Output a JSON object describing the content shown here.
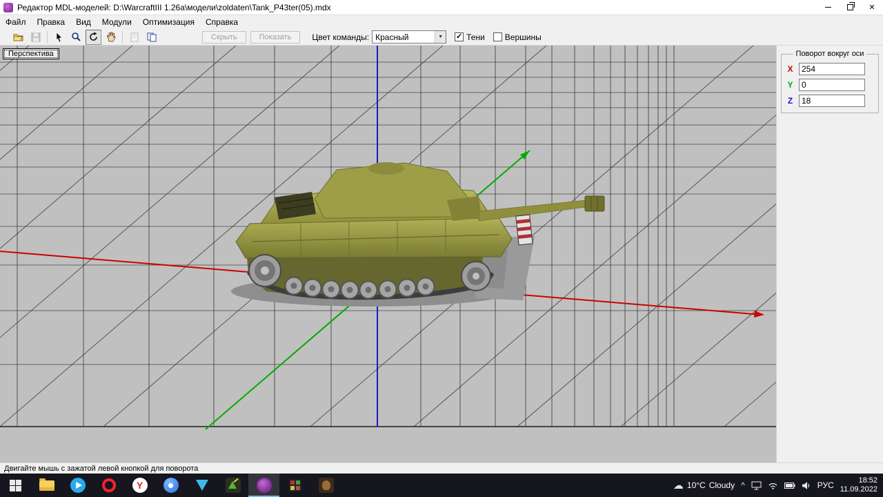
{
  "window": {
    "title": "Редактор MDL-моделей: D:\\WarcraftIII 1.26a\\модели\\zoldaten\\Tank_P43ter(05).mdx"
  },
  "menu": {
    "items": [
      "Файл",
      "Правка",
      "Вид",
      "Модули",
      "Оптимизация",
      "Справка"
    ]
  },
  "toolbar": {
    "hide_label": "Скрыть",
    "show_label": "Показать",
    "team_color_label": "Цвет команды:",
    "team_color_value": "Красный",
    "shadows_label": "Тени",
    "vertices_label": "Вершины"
  },
  "viewport": {
    "label": "Перспектива"
  },
  "rotation": {
    "title": "Поворот вокруг оси",
    "x_label": "X",
    "x_value": "254",
    "y_label": "Y",
    "y_value": "0",
    "z_label": "Z",
    "z_value": "18"
  },
  "status": {
    "text": "Двигайте мышь с зажатой левой кнопкой для поворота"
  },
  "taskbar": {
    "weather": {
      "icon": "☁",
      "temp": "10°C",
      "condition": "Cloudy"
    },
    "tray_expand": "^",
    "language": "РУС",
    "time": "18:52",
    "date": "11.09.2022"
  },
  "icons": {
    "check": "✓",
    "dropdown_arrow": "▼",
    "close": "✕",
    "yandex_letter": "Y"
  },
  "colors": {
    "axis_x": "#cc0000",
    "axis_y": "#00aa00",
    "axis_z": "#1a1acc",
    "viewport_bg": "#c0c0c0",
    "tank_olive": "#9e9e46"
  }
}
